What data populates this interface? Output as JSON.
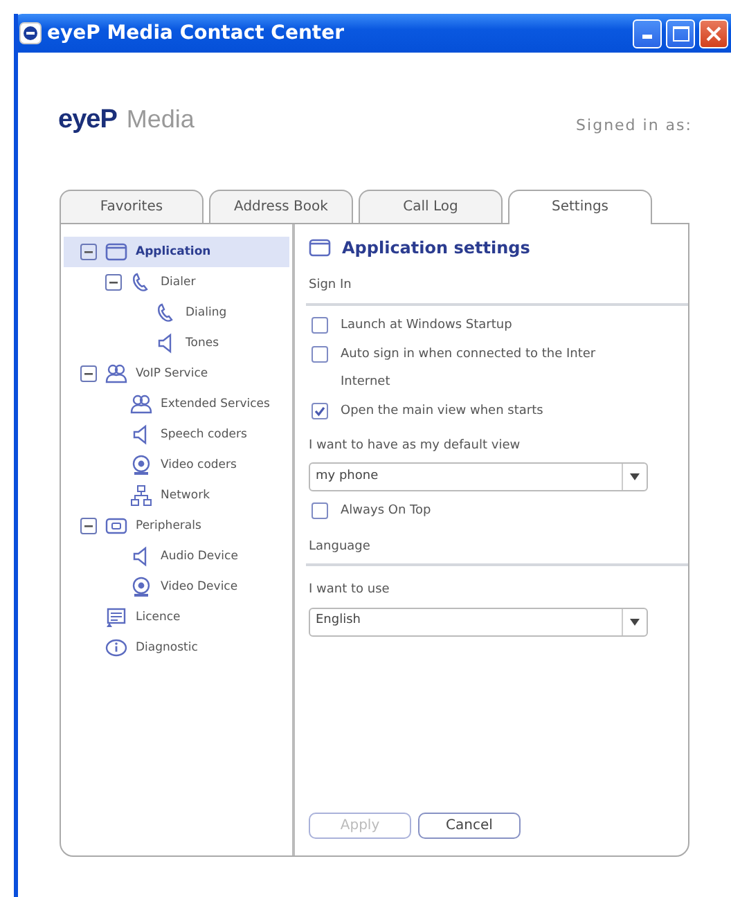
{
  "window": {
    "title": "eyeP Media Contact Center"
  },
  "logo": {
    "brand": "eyeP",
    "name": "Media"
  },
  "signed_in": "Signed in as:",
  "tabs": [
    {
      "label": "Favorites",
      "selected": false
    },
    {
      "label": "Address Book",
      "selected": false
    },
    {
      "label": "Call Log",
      "selected": false
    },
    {
      "label": "Settings",
      "selected": true
    }
  ],
  "tree": [
    {
      "label": "Application",
      "kind": "window",
      "expanded": true,
      "selected": true,
      "children": [
        {
          "label": "Dialer",
          "kind": "phone",
          "expanded": true,
          "selected": false,
          "children": [
            {
              "label": "Dialing",
              "kind": "phone",
              "selected": false
            },
            {
              "label": "Tones",
              "kind": "speaker",
              "selected": false
            }
          ]
        }
      ]
    },
    {
      "label": "VoIP Service",
      "kind": "people",
      "expanded": true,
      "selected": false,
      "children": [
        {
          "label": "Extended Services",
          "kind": "people",
          "selected": false
        },
        {
          "label": "Speech coders",
          "kind": "speaker",
          "selected": false
        },
        {
          "label": "Video coders",
          "kind": "webcam",
          "selected": false
        },
        {
          "label": "Network",
          "kind": "network",
          "selected": false
        }
      ]
    },
    {
      "label": "Peripherals",
      "kind": "device",
      "expanded": true,
      "selected": false,
      "children": [
        {
          "label": "Audio Device",
          "kind": "speaker",
          "selected": false
        },
        {
          "label": "Video Device",
          "kind": "webcam",
          "selected": false
        }
      ]
    },
    {
      "label": "Licence",
      "kind": "licence",
      "selected": false
    },
    {
      "label": "Diagnostic",
      "kind": "info",
      "selected": false
    }
  ],
  "settings": {
    "title": "Application settings",
    "items": [
      {
        "kind": "heading",
        "text": "Sign In"
      },
      {
        "kind": "checkbox",
        "lines": [
          "Launch at Windows Startup"
        ],
        "checked": false
      },
      {
        "kind": "checkbox",
        "lines": [
          "Auto sign in when connected to the Inter",
          "Internet"
        ],
        "checked": false
      },
      {
        "kind": "checkbox",
        "lines": [
          "Open the main view when starts"
        ],
        "checked": true
      },
      {
        "kind": "label",
        "text": "I want to have as my default view"
      },
      {
        "kind": "select",
        "value": "my phone"
      },
      {
        "kind": "checkbox",
        "lines": [
          "Always On Top"
        ],
        "checked": false
      },
      {
        "kind": "heading",
        "text": "Language"
      },
      {
        "kind": "label",
        "text": "I want to use"
      },
      {
        "kind": "select",
        "value": "English"
      }
    ]
  },
  "buttons": [
    {
      "label": "Apply",
      "disabled": true
    },
    {
      "label": "Cancel",
      "disabled": false
    }
  ]
}
